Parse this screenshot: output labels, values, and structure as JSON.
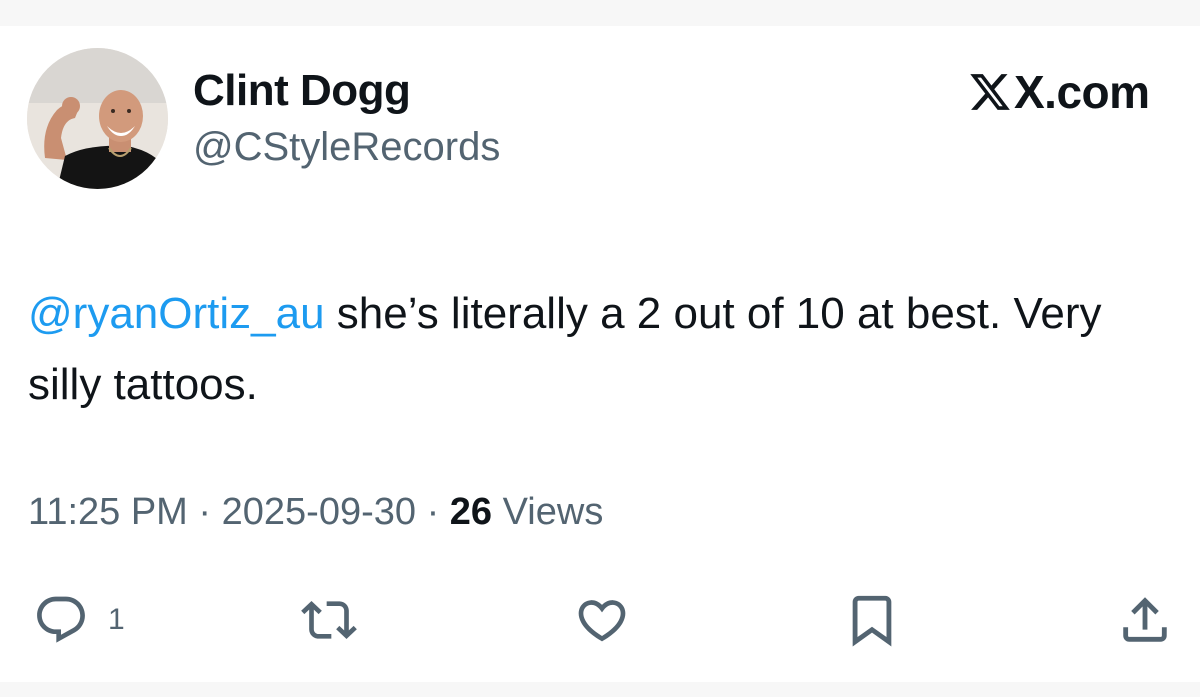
{
  "author": {
    "display_name": "Clint Dogg",
    "handle": "@CStyleRecords",
    "avatar": "profile-photo"
  },
  "brand": {
    "label": "X.com",
    "icon": "x-logo-icon"
  },
  "tweet": {
    "mention": "@ryanOrtiz_au",
    "text": " she’s literally a 2 out of 10 at best. Very silly tattoos."
  },
  "meta": {
    "time": "11:25 PM",
    "separator": " · ",
    "date": "2025-09-30",
    "views_count": "26",
    "views_label": " Views"
  },
  "actions": {
    "reply": {
      "icon": "reply-icon",
      "count": "1"
    },
    "retweet": {
      "icon": "retweet-icon"
    },
    "like": {
      "icon": "heart-icon"
    },
    "bookmark": {
      "icon": "bookmark-icon"
    },
    "share": {
      "icon": "share-icon"
    }
  },
  "colors": {
    "text": "#0f1419",
    "secondary": "#536471",
    "link": "#1d9bf0",
    "background": "#ffffff"
  }
}
